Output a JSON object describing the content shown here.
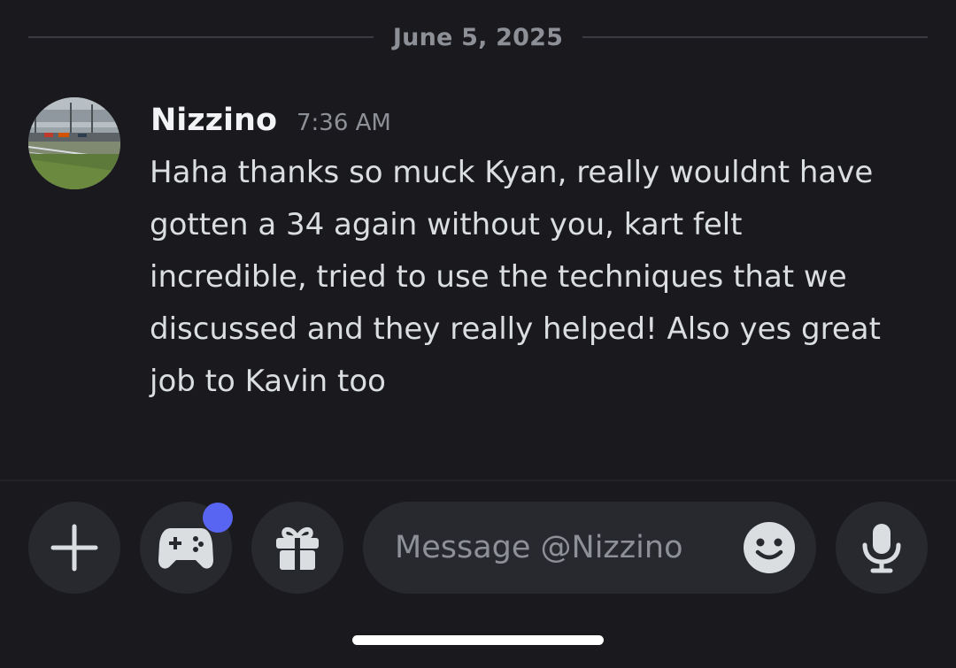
{
  "chat": {
    "date_divider": "June 5, 2025",
    "message": {
      "author": "Nizzino",
      "time": "7:36 AM",
      "lines": [
        "Haha thanks so muck Kyan, really wouldnt have",
        "gotten a 34 again without you, kart felt",
        "incredible, tried to use the techniques that we",
        "discussed and they really helped! Also yes great",
        "job to Kavin too"
      ]
    }
  },
  "composer": {
    "placeholder": "Message @Nizzino",
    "buttons": {
      "plus_icon": "plus-icon",
      "activities_icon": "gamepad-icon",
      "gift_icon": "gift-icon",
      "emoji_icon": "smiley-icon",
      "mic_icon": "microphone-icon"
    },
    "activity_notification": true
  },
  "colors": {
    "background": "#1a1a1e",
    "button_bg": "#28292e",
    "accent_dot": "#5865f2",
    "muted_text": "#8e9097",
    "body_text": "#dbdee1",
    "username": "#f2f3f5"
  }
}
